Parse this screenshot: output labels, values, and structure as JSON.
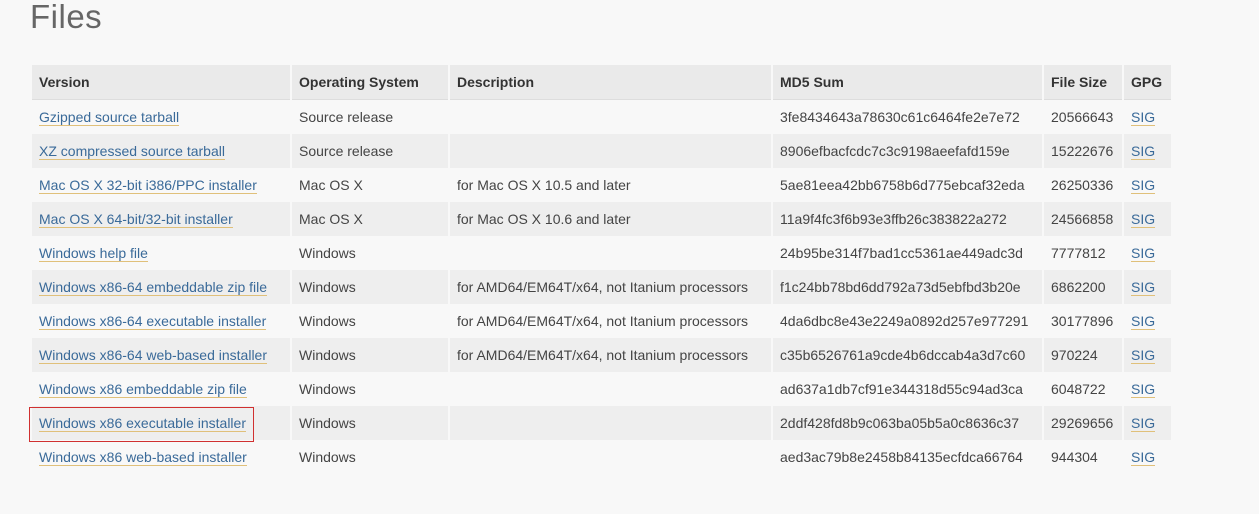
{
  "page": {
    "title": "Files"
  },
  "table": {
    "headers": {
      "version": "Version",
      "os": "Operating System",
      "description": "Description",
      "md5": "MD5 Sum",
      "size": "File Size",
      "gpg": "GPG"
    },
    "rows": [
      {
        "version": "Gzipped source tarball",
        "os": "Source release",
        "description": "",
        "md5": "3fe8434643a78630c61c6464fe2e7e72",
        "size": "20566643",
        "gpg": "SIG"
      },
      {
        "version": "XZ compressed source tarball",
        "os": "Source release",
        "description": "",
        "md5": "8906efbacfcdc7c3c9198aeefafd159e",
        "size": "15222676",
        "gpg": "SIG"
      },
      {
        "version": "Mac OS X 32-bit i386/PPC installer",
        "os": "Mac OS X",
        "description": "for Mac OS X 10.5 and later",
        "md5": "5ae81eea42bb6758b6d775ebcaf32eda",
        "size": "26250336",
        "gpg": "SIG"
      },
      {
        "version": "Mac OS X 64-bit/32-bit installer",
        "os": "Mac OS X",
        "description": "for Mac OS X 10.6 and later",
        "md5": "11a9f4fc3f6b93e3ffb26c383822a272",
        "size": "24566858",
        "gpg": "SIG"
      },
      {
        "version": "Windows help file",
        "os": "Windows",
        "description": "",
        "md5": "24b95be314f7bad1cc5361ae449adc3d",
        "size": "7777812",
        "gpg": "SIG"
      },
      {
        "version": "Windows x86-64 embeddable zip file",
        "os": "Windows",
        "description": "for AMD64/EM64T/x64, not Itanium processors",
        "md5": "f1c24bb78bd6dd792a73d5ebfbd3b20e",
        "size": "6862200",
        "gpg": "SIG"
      },
      {
        "version": "Windows x86-64 executable installer",
        "os": "Windows",
        "description": "for AMD64/EM64T/x64, not Itanium processors",
        "md5": "4da6dbc8e43e2249a0892d257e977291",
        "size": "30177896",
        "gpg": "SIG"
      },
      {
        "version": "Windows x86-64 web-based installer",
        "os": "Windows",
        "description": "for AMD64/EM64T/x64, not Itanium processors",
        "md5": "c35b6526761a9cde4b6dccab4a3d7c60",
        "size": "970224",
        "gpg": "SIG"
      },
      {
        "version": "Windows x86 embeddable zip file",
        "os": "Windows",
        "description": "",
        "md5": "ad637a1db7cf91e344318d55c94ad3ca",
        "size": "6048722",
        "gpg": "SIG"
      },
      {
        "version": "Windows x86 executable installer",
        "os": "Windows",
        "description": "",
        "md5": "2ddf428fd8b9c063ba05b5a0c8636c37",
        "size": "29269656",
        "gpg": "SIG",
        "highlighted": true
      },
      {
        "version": "Windows x86 web-based installer",
        "os": "Windows",
        "description": "",
        "md5": "aed3ac79b8e2458b84135ecfdca66764",
        "size": "944304",
        "gpg": "SIG"
      }
    ]
  },
  "colors": {
    "link": "#3a6a99",
    "link_underline": "#e0c07a",
    "highlight_border": "#d03030",
    "header_bg": "#eaeaea",
    "row_alt_bg": "#eeeeee"
  }
}
